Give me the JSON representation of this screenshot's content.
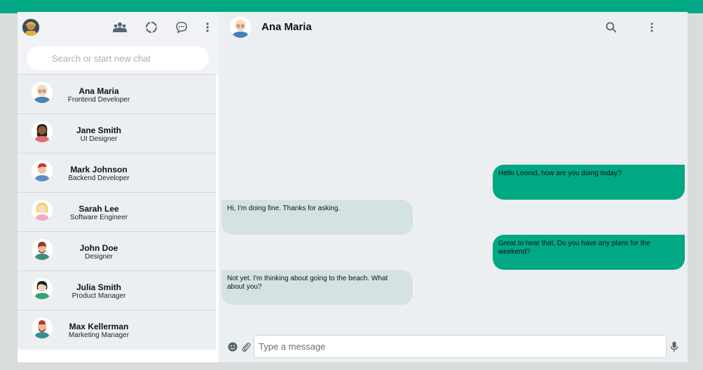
{
  "header": {
    "contact_name": "Ana Maria"
  },
  "icons": {
    "community": "users-icon",
    "status": "status-ring-icon",
    "new_chat": "chat-bubble-icon",
    "menu": "kebab-menu-icon",
    "search": "search-icon",
    "emoji": "emoji-icon",
    "attach": "paperclip-icon",
    "mic": "microphone-icon"
  },
  "search": {
    "placeholder": "Search or start new chat"
  },
  "contacts": [
    {
      "name": "Ana Maria",
      "role": "Frontend Developer"
    },
    {
      "name": "Jane Smith",
      "role": "UI Designer"
    },
    {
      "name": "Mark Johnson",
      "role": "Backend Developer"
    },
    {
      "name": "Sarah Lee",
      "role": "Software Engineer"
    },
    {
      "name": "John Doe",
      "role": "Designer"
    },
    {
      "name": "Julia Smith",
      "role": "Product Manager"
    },
    {
      "name": "Max Kellerman",
      "role": "Marketing Manager"
    }
  ],
  "messages": [
    {
      "direction": "out",
      "text": "Hello Leonid, how are you doing today?"
    },
    {
      "direction": "in",
      "text": "Hi, I'm doing fine. Thanks for asking."
    },
    {
      "direction": "out",
      "text": "Great to hear that. Do you have any plans for the weekend?"
    },
    {
      "direction": "in",
      "text": "Not yet. I'm thinking about going to the beach. What about you?"
    }
  ],
  "composer": {
    "placeholder": "Type a message"
  },
  "colors": {
    "accent": "#00a884",
    "incoming_bubble": "#d5e2e2",
    "panel": "#eceff1"
  }
}
